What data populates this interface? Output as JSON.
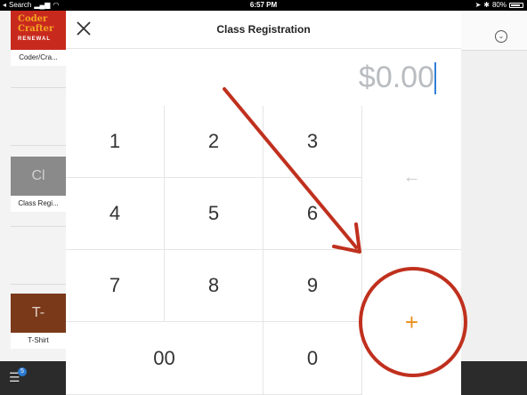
{
  "status_bar": {
    "carrier": "Search",
    "time": "6:57 PM",
    "battery": "80%"
  },
  "background_app": {
    "items": [
      {
        "image_text": "Coder Crafter",
        "image_subtext": "RENEWAL",
        "label": "Coder/Cra..."
      },
      {
        "image_text": "",
        "label": ""
      },
      {
        "image_text": "Cl",
        "label": "Class Regi..."
      },
      {
        "image_text": "",
        "label": ""
      },
      {
        "image_text": "T-",
        "label": "T-Shirt"
      }
    ],
    "cart_badge": "5",
    "icons": {
      "menu": "hamburger-icon",
      "chevron": "chevron-down-icon"
    }
  },
  "modal": {
    "title": "Class Registration",
    "amount": "$0.00",
    "keys": {
      "k1": "1",
      "k2": "2",
      "k3": "3",
      "k4": "4",
      "k5": "5",
      "k6": "6",
      "k7": "7",
      "k8": "8",
      "k9": "9",
      "k00": "00",
      "k0": "0",
      "backspace": "←",
      "add": "+"
    },
    "icons": {
      "close": "close-icon",
      "backspace": "backspace-arrow-icon",
      "add": "plus-icon"
    }
  },
  "colors": {
    "accent_plus": "#e8901a",
    "amount_placeholder": "#b8bcc0",
    "annotation_red": "#c0301e",
    "caret_blue": "#2f7fd6"
  }
}
